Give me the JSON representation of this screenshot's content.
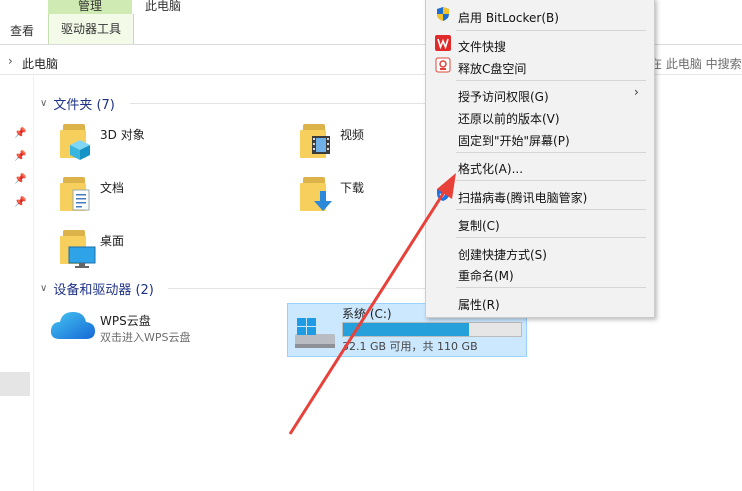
{
  "ribbon": {
    "window_title": "此电脑",
    "manage_tab": "管理",
    "view_tab": "查看",
    "drive_tools_tab": "驱动器工具"
  },
  "address": {
    "path": "此电脑",
    "search_hint": "在 此电脑 中搜索"
  },
  "folders_section": {
    "header": "文件夹 (7)",
    "items": [
      {
        "label": "3D 对象"
      },
      {
        "label": "视频"
      },
      {
        "label": "文档"
      },
      {
        "label": "下载"
      },
      {
        "label": "桌面"
      }
    ]
  },
  "devices_section": {
    "header": "设备和驱动器 (2)",
    "wps": {
      "title": "WPS云盘",
      "subtitle": "双击进入WPS云盘"
    },
    "drive_c": {
      "title": "系统 (C:)",
      "detail": "32.1 GB 可用，共 110 GB",
      "used_fraction": 0.71
    }
  },
  "context_menu": {
    "items": [
      {
        "label": "启用 BitLocker(B)",
        "icon": "shield-icon"
      },
      {
        "label": "文件快搜",
        "icon": "wps-icon"
      },
      {
        "label": "释放C盘空间",
        "icon": "cleanup-icon"
      },
      {
        "label": "授予访问权限(G)"
      },
      {
        "label": "还原以前的版本(V)"
      },
      {
        "label": "固定到\"开始\"屏幕(P)"
      },
      {
        "label": "格式化(A)..."
      },
      {
        "label": "扫描病毒(腾讯电脑管家)",
        "icon": "tencent-shield-icon"
      },
      {
        "label": "复制(C)"
      },
      {
        "label": "创建快捷方式(S)"
      },
      {
        "label": "重命名(M)"
      },
      {
        "label": "属性(R)"
      }
    ]
  },
  "colors": {
    "accent": "#26a0da",
    "selection": "#cce8ff",
    "manage_tab": "#cfeab2",
    "annotation_arrow": "#e8413a"
  }
}
